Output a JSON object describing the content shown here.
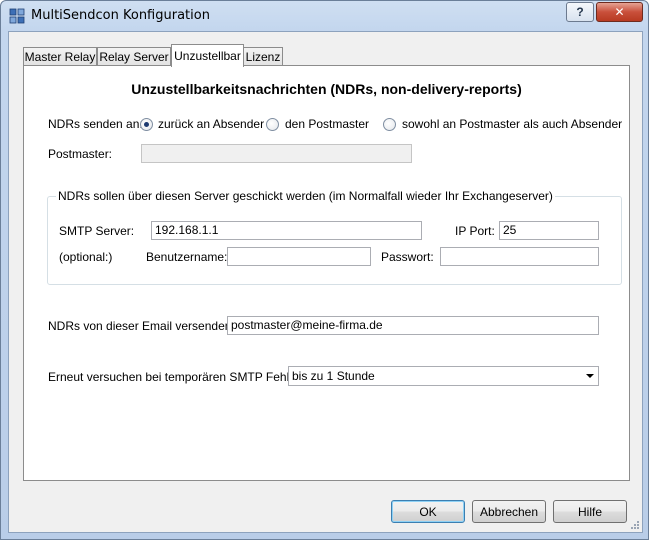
{
  "window": {
    "title": "MultiSendcon Konfiguration",
    "help_label": "?",
    "close_label": "✕"
  },
  "tabs": [
    {
      "label": "Master Relay",
      "active": false
    },
    {
      "label": "Relay Server",
      "active": false
    },
    {
      "label": "Unzustellbar",
      "active": true
    },
    {
      "label": "Lizenz",
      "active": false
    }
  ],
  "panel": {
    "heading": "Unzustellbarkeitsnachrichten (NDRs, non-delivery-reports)",
    "ndr_send_label": "NDRs senden an:",
    "radio_options": [
      {
        "label": "zurück an Absender",
        "checked": true
      },
      {
        "label": "den Postmaster",
        "checked": false
      },
      {
        "label": "sowohl an Postmaster als auch Absender",
        "checked": false
      }
    ],
    "postmaster_label": "Postmaster:",
    "postmaster_value": "",
    "group": {
      "title": "NDRs sollen über diesen Server geschickt werden (im Normalfall wieder Ihr Exchangeserver)",
      "smtp_label": "SMTP Server:",
      "smtp_value": "192.168.1.1",
      "port_label": "IP Port:",
      "port_value": "25",
      "optional_label": "(optional:)",
      "user_label": "Benutzername:",
      "user_value": "",
      "password_label": "Passwort:",
      "password_value": ""
    },
    "from_email_label": "NDRs von dieser Email versenden:",
    "from_email_value": "postmaster@meine-firma.de",
    "retry_label": "Erneut versuchen bei temporären SMTP Fehlern:",
    "retry_value": "bis zu 1 Stunde"
  },
  "buttons": {
    "ok": "OK",
    "cancel": "Abbrechen",
    "help": "Hilfe"
  }
}
